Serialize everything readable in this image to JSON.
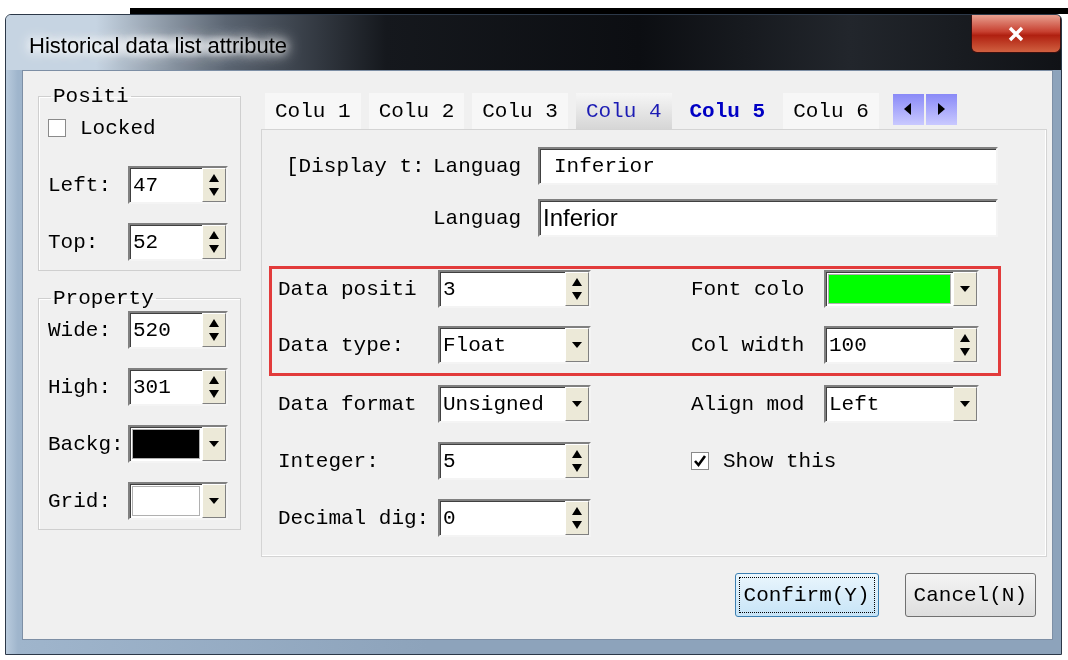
{
  "window": {
    "title": "Historical data list attribute"
  },
  "position_group": {
    "title": "Positi",
    "locked": {
      "kind": "check",
      "label": "Locked",
      "checked": false
    },
    "fields": [
      {
        "kind": "spin",
        "label": "Left:",
        "value": "47"
      },
      {
        "kind": "spin",
        "label": "Top:",
        "value": "52"
      }
    ]
  },
  "property_group": {
    "title": "Property",
    "fields": [
      {
        "kind": "spin",
        "label": "Wide:",
        "value": "520"
      },
      {
        "kind": "spin",
        "label": "High:",
        "value": "301"
      },
      {
        "kind": "color",
        "label": "Backg:",
        "color": "#000000"
      },
      {
        "kind": "color",
        "label": "Grid:",
        "color": "#ffffff"
      }
    ]
  },
  "tabs": [
    {
      "label": "Colu 1",
      "selected": false,
      "hovered": false
    },
    {
      "label": "Colu 2",
      "selected": false,
      "hovered": false
    },
    {
      "label": "Colu 3",
      "selected": false,
      "hovered": false
    },
    {
      "label": "Colu 4",
      "selected": false,
      "hovered": true
    },
    {
      "label": "Colu 5",
      "selected": true,
      "hovered": false
    },
    {
      "label": "Colu 6",
      "selected": false,
      "hovered": false
    }
  ],
  "display_text": {
    "label": "[Display t:",
    "languages": [
      {
        "kind": "text",
        "label": "Languag",
        "value": "Inferior"
      },
      {
        "kind": "text",
        "label": "Languag",
        "value": "Inferior"
      }
    ]
  },
  "highlighted_rows": [
    {
      "left": {
        "kind": "spin",
        "label": "Data positi",
        "value": "3"
      },
      "right": {
        "kind": "color",
        "label": "Font colo",
        "color": "#00ff00"
      }
    },
    {
      "left": {
        "kind": "combo",
        "label": "Data type:",
        "value": "Float"
      },
      "right": {
        "kind": "spin",
        "label": "Col width",
        "value": "100"
      }
    }
  ],
  "rows": [
    {
      "left": {
        "kind": "combo",
        "label": "Data format",
        "value": "Unsigned"
      },
      "right": {
        "kind": "combo",
        "label": "Align mod",
        "value": "Left"
      }
    },
    {
      "left": {
        "kind": "spin",
        "label": "Integer:",
        "value": "5"
      },
      "right": {
        "kind": "check",
        "label": "Show this",
        "checked": true
      }
    },
    {
      "left": {
        "kind": "spin",
        "label": "Decimal dig:",
        "value": "0"
      }
    }
  ],
  "buttons": [
    {
      "label": "Confirm(Y)",
      "focused": true
    },
    {
      "label": "Cancel(N)",
      "focused": false
    }
  ]
}
